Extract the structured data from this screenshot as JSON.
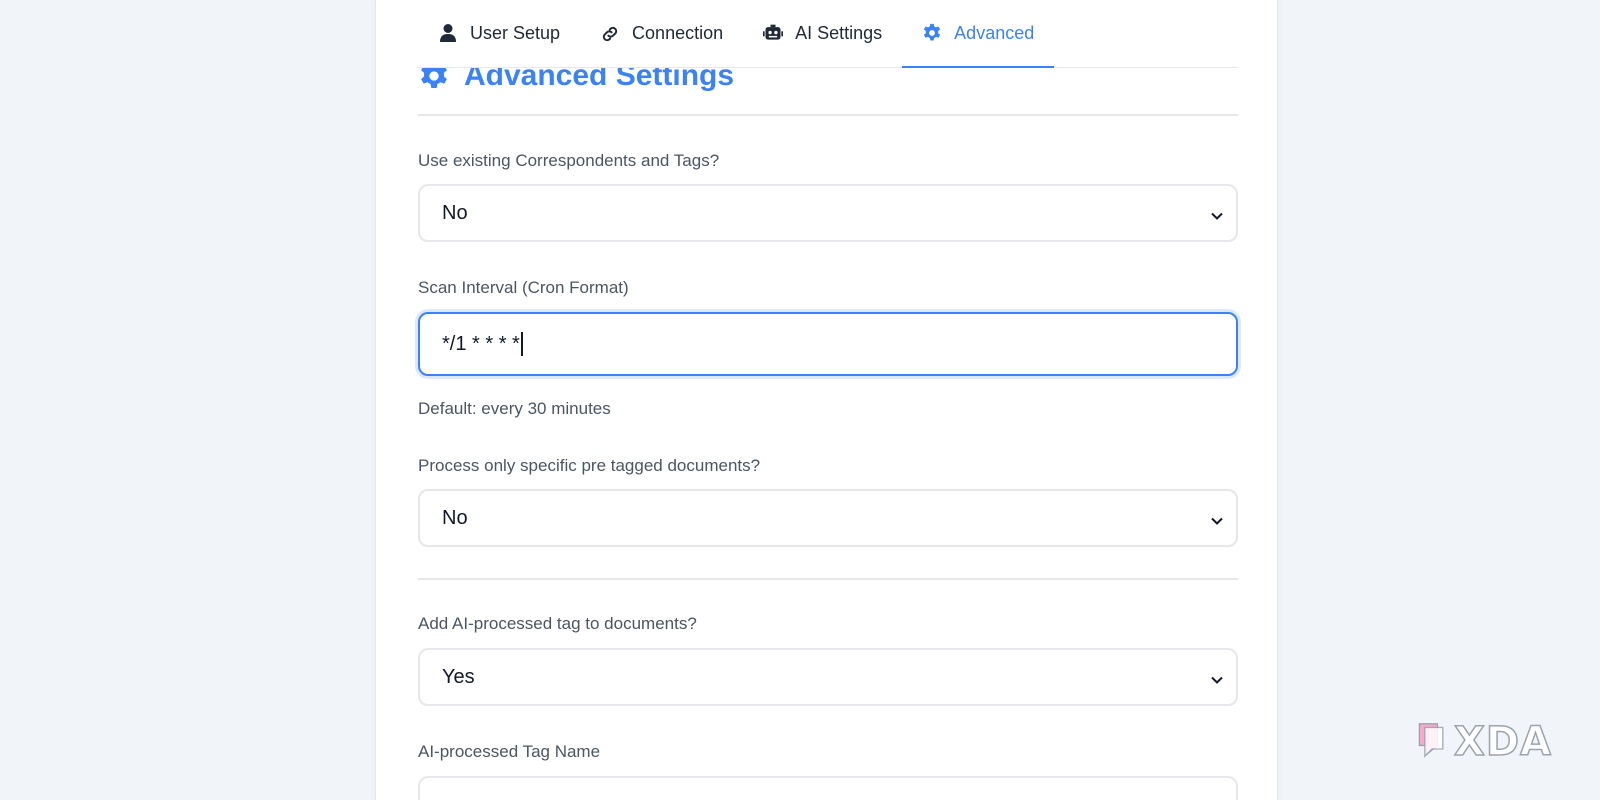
{
  "tabs": [
    {
      "label": "User Setup",
      "icon": "user-icon"
    },
    {
      "label": "Connection",
      "icon": "link-icon"
    },
    {
      "label": "AI Settings",
      "icon": "robot-icon"
    },
    {
      "label": "Advanced",
      "icon": "gear-icon",
      "active": true
    }
  ],
  "section": {
    "title": "Advanced Settings",
    "icon": "gear-icon"
  },
  "fields": {
    "use_existing": {
      "label": "Use existing Correspondents and Tags?",
      "value": "No"
    },
    "scan_interval": {
      "label": "Scan Interval (Cron Format)",
      "value": "*/1 * * * *",
      "hint": "Default: every 30 minutes"
    },
    "pre_tagged": {
      "label": "Process only specific pre tagged documents?",
      "value": "No"
    },
    "add_tag": {
      "label": "Add AI-processed tag to documents?",
      "value": "Yes"
    },
    "tag_name": {
      "label": "AI-processed Tag Name"
    }
  },
  "watermark": {
    "text": "XDA"
  },
  "colors": {
    "accent": "#3b82f6",
    "background": "#f1f4f9",
    "border": "#e5e7eb"
  }
}
